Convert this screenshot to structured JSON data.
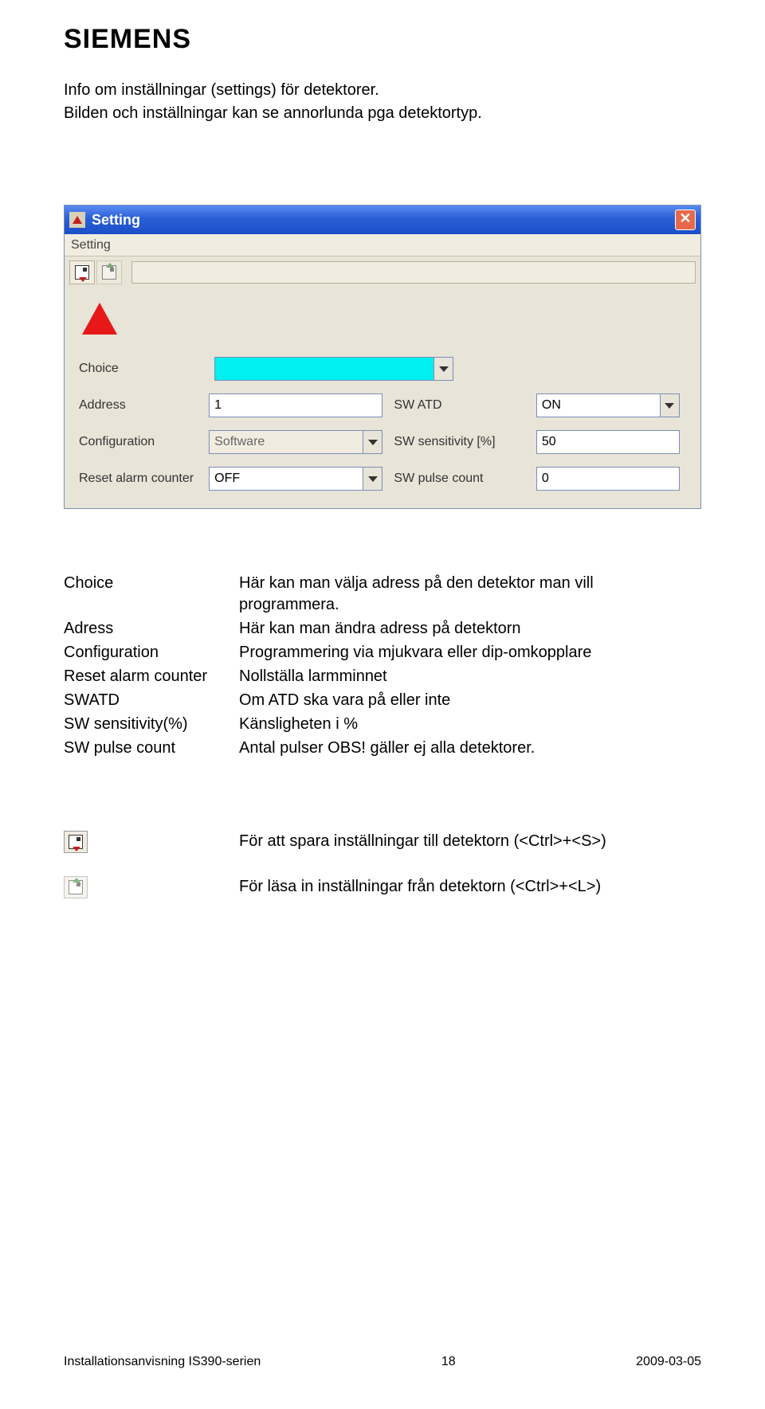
{
  "logo": "SIEMENS",
  "intro": {
    "line1": "Info om inställningar (settings) för detektorer.",
    "line2": "Bilden och inställningar kan se annorlunda pga detektortyp."
  },
  "window": {
    "title": "Setting",
    "menu": "Setting",
    "labels": {
      "choice": "Choice",
      "address": "Address",
      "configuration": "Configuration",
      "reset_alarm": "Reset alarm counter",
      "sw_atd": "SW ATD",
      "sw_sens": "SW sensitivity [%]",
      "sw_pulse": "SW pulse count"
    },
    "values": {
      "choice": "",
      "address": "1",
      "configuration": "Software",
      "reset_alarm": "OFF",
      "sw_atd": "ON",
      "sw_sens": "50",
      "sw_pulse": "0"
    }
  },
  "defs": [
    {
      "term": "Choice",
      "desc1": "Här kan man välja adress på den detektor man vill",
      "desc2": "programmera."
    },
    {
      "term": "Adress",
      "desc1": "Här kan man ändra adress på detektorn"
    },
    {
      "term": "Configuration",
      "desc1": "Programmering via mjukvara eller dip-omkopplare"
    },
    {
      "term": "Reset alarm counter",
      "desc1": "Nollställa larmminnet"
    },
    {
      "term": "SWATD",
      "desc1": "Om ATD ska vara på eller inte"
    },
    {
      "term": "SW sensitivity(%)",
      "desc1": "Känsligheten i %"
    },
    {
      "term": "SW pulse count",
      "desc1": "Antal pulser OBS! gäller ej alla detektorer."
    }
  ],
  "icon_notes": {
    "save": "För att spara inställningar till detektorn (<Ctrl>+<S>)",
    "load": "För läsa in inställningar från detektorn (<Ctrl>+<L>)"
  },
  "footer": {
    "left": "Installationsanvisning IS390-serien",
    "center": "18",
    "right": "2009-03-05"
  }
}
